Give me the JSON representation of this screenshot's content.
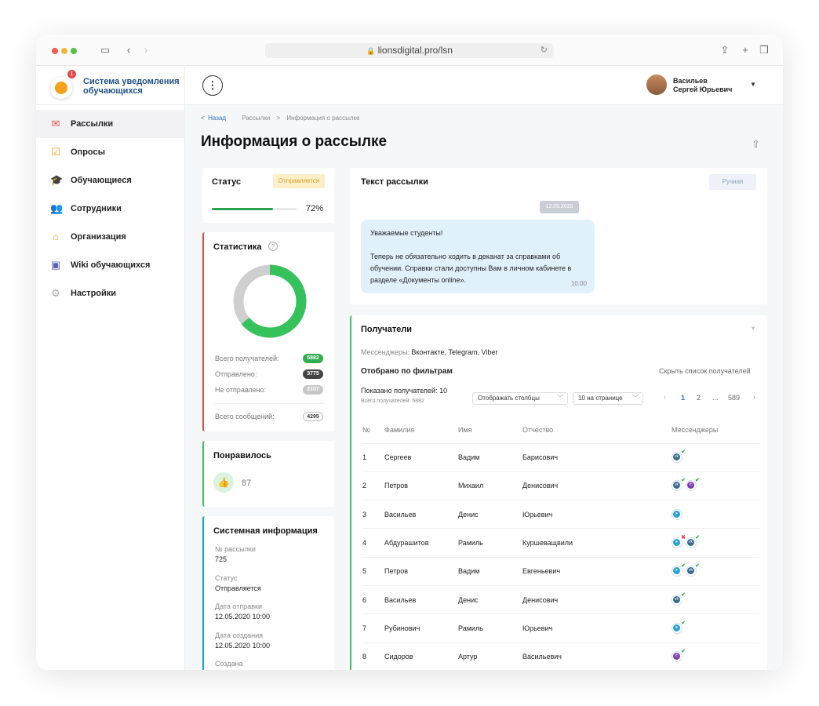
{
  "browser": {
    "url": "lionsdigital.pro/lsn"
  },
  "app": {
    "title": "Система уведомления обучающихся",
    "badge": "1"
  },
  "nav": [
    {
      "label": "Рассылки",
      "icon": "mail-icon",
      "color": "#e24b4b"
    },
    {
      "label": "Опросы",
      "icon": "checkbox-icon",
      "color": "#f0a21a"
    },
    {
      "label": "Обучающиеся",
      "icon": "graduation-cap-icon",
      "color": "#1aa1c7"
    },
    {
      "label": "Сотрудники",
      "icon": "users-icon",
      "color": "#8e3fae"
    },
    {
      "label": "Организация",
      "icon": "home-icon",
      "color": "#f0a21a"
    },
    {
      "label": "Wiki обучающихся",
      "icon": "book-icon",
      "color": "#5a5fb8"
    },
    {
      "label": "Настройки",
      "icon": "gear-icon",
      "color": "#aaaaaa"
    }
  ],
  "user": {
    "line1": "Васильев",
    "line2": "Сергей Юрьевич"
  },
  "breadcrumbs": {
    "back": "Назад",
    "level1": "Рассылки",
    "level2": "Информация о рассылке"
  },
  "page_title": "Информация о рассылке",
  "status_card": {
    "title": "Статус",
    "badge": "Отправляется",
    "progress_label": "72%",
    "progress": 0.72
  },
  "stats_card": {
    "title": "Статистика",
    "help": "?",
    "total_label": "Всего получателей:",
    "total_value": "5882",
    "sent_label": "Отправлено:",
    "sent_value": "3775",
    "not_sent_label": "Не отправлено:",
    "not_sent_value": "2107",
    "messages_label": "Всего сообщений:",
    "messages_value": "4295",
    "colors": {
      "sent": "#35c25c",
      "not_sent": "#cfcfcf"
    }
  },
  "likes_card": {
    "title": "Понравилось",
    "count": "87"
  },
  "system_card": {
    "title": "Системная информация",
    "fields": [
      {
        "label": "№ рассылки",
        "value": "725"
      },
      {
        "label": "Статус",
        "value": "Отправляется"
      },
      {
        "label": "Дата отправки",
        "value": "12.05.2020    10:00"
      },
      {
        "label": "Дата создания",
        "value": "12.05.2020    10:00"
      },
      {
        "label": "Создана",
        "value": ""
      }
    ]
  },
  "message_card": {
    "title": "Текст рассылки",
    "mode_button": "Ручная",
    "date": "12.05.2020",
    "greeting": "Уважаемые студенты!",
    "body": "Теперь не обязательно ходить в деканат за справками об обучении. Справки стали доступны Вам в личном кабинете в разделе «Документы online».",
    "time": "10:00"
  },
  "recipients_card": {
    "title": "Получатели",
    "messengers_label": "Мессенджеры:",
    "messengers_value": "Вконтакте, Telegram, Viber",
    "filtered_title": "Отобрано по фильтрам",
    "hide_link": "Скрыть список получателей",
    "shown_label": "Показано получателей: 10",
    "total_label": "Всего получателей: 5882",
    "columns_select": "Отображать столбцы",
    "per_page_select": "10 на странице",
    "pagination": [
      "1",
      "2",
      "...",
      "589"
    ],
    "headers": [
      "№",
      "Фамилия",
      "Имя",
      "Отчество",
      "Мессенджеры"
    ],
    "rows": [
      {
        "n": "1",
        "last": "Сергеев",
        "first": "Вадим",
        "middle": "Барисович",
        "m": [
          [
            "vk",
            "ok"
          ]
        ]
      },
      {
        "n": "2",
        "last": "Петров",
        "first": "Михаил",
        "middle": "Денисович",
        "m": [
          [
            "vk",
            "ok"
          ],
          [
            "viber",
            "ok"
          ]
        ]
      },
      {
        "n": "3",
        "last": "Васильев",
        "first": "Денис",
        "middle": "Юрьевич",
        "m": [
          [
            "telegram",
            "none"
          ]
        ]
      },
      {
        "n": "4",
        "last": "Абдурашитов",
        "first": "Рамиль",
        "middle": "Куршеващвили",
        "m": [
          [
            "telegram",
            "fail"
          ],
          [
            "vk",
            "ok"
          ]
        ]
      },
      {
        "n": "5",
        "last": "Петров",
        "first": "Вадим",
        "middle": "Евгеньевич",
        "m": [
          [
            "telegram",
            "ok"
          ],
          [
            "vk",
            "ok"
          ]
        ]
      },
      {
        "n": "6",
        "last": "Васильев",
        "first": "Денис",
        "middle": "Денисович",
        "m": [
          [
            "vk",
            "ok"
          ]
        ]
      },
      {
        "n": "7",
        "last": "Рубинович",
        "first": "Рамиль",
        "middle": "Юрьевич",
        "m": [
          [
            "telegram",
            "ok"
          ]
        ]
      },
      {
        "n": "8",
        "last": "Сидоров",
        "first": "Артур",
        "middle": "Васильевич",
        "m": [
          [
            "viber",
            "ok"
          ]
        ]
      }
    ]
  }
}
